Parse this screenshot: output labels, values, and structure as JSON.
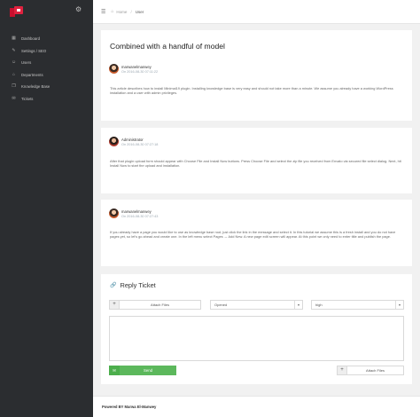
{
  "sidebar": {
    "items": [
      {
        "label": "Dashboard",
        "icon": "dashboard-icon",
        "glyph": "▦"
      },
      {
        "label": "Settings / SEO",
        "icon": "settings-icon",
        "glyph": "✎"
      },
      {
        "label": "Users",
        "icon": "users-icon",
        "glyph": "☺"
      },
      {
        "label": "Departments",
        "icon": "departments-icon",
        "glyph": "⌂"
      },
      {
        "label": "Knowledge Base",
        "icon": "book-icon",
        "glyph": "❐"
      },
      {
        "label": "Tickets",
        "icon": "ticket-icon",
        "glyph": "✉"
      }
    ]
  },
  "topbar": {
    "menu_glyph": "☰",
    "home_glyph": "⌂",
    "breadcrumb_home": "Home",
    "breadcrumb_separator": "/",
    "breadcrumb_current": "User"
  },
  "ticket": {
    "title": "Combined with a handful of model"
  },
  "messages": [
    {
      "author": "marwanelmanwey",
      "date": "On 2016-08-30 07:11:22",
      "body": "This article describes how to install Minimal19 plugin. Installing knowledge base is very easy and should not take more than a minute. We assume you already have a working WordPress installation and a user with admin privileges."
    },
    {
      "author": "Administrator",
      "date": "On 2016-08-30 07:27:18",
      "body": "After that plugin upload form should appear with Choose File and Install Now buttons. Press Choose File and select the zip file you received from Envato via secured file select dialog. Next, hit Install Now to start the upload and installation."
    },
    {
      "author": "marwanelmanwey",
      "date": "On 2016-08-30 07:27:43",
      "body": "If you already have a page you would like to use as knowledge base root, just click the link in the message and select it. In this tutorial we assume this is a fresh install and you do not have pages yet, so let's go ahead and create one. In the left menu select Pages → Add New. A new page edit screen will appear. At this point we only need to enter title and publish the page."
    }
  ],
  "reply": {
    "title": "Reply Ticket",
    "title_glyph": "🔗",
    "attach_label": "Attach Files",
    "attach_glyph": "+",
    "status_value": "Opened",
    "priority_value": "high",
    "chevron_glyph": "▾",
    "message_placeholder": "",
    "send_label": "Send",
    "send_glyph": "✉"
  },
  "footer": {
    "text": "Powered BY Marwa El-Manwey"
  }
}
